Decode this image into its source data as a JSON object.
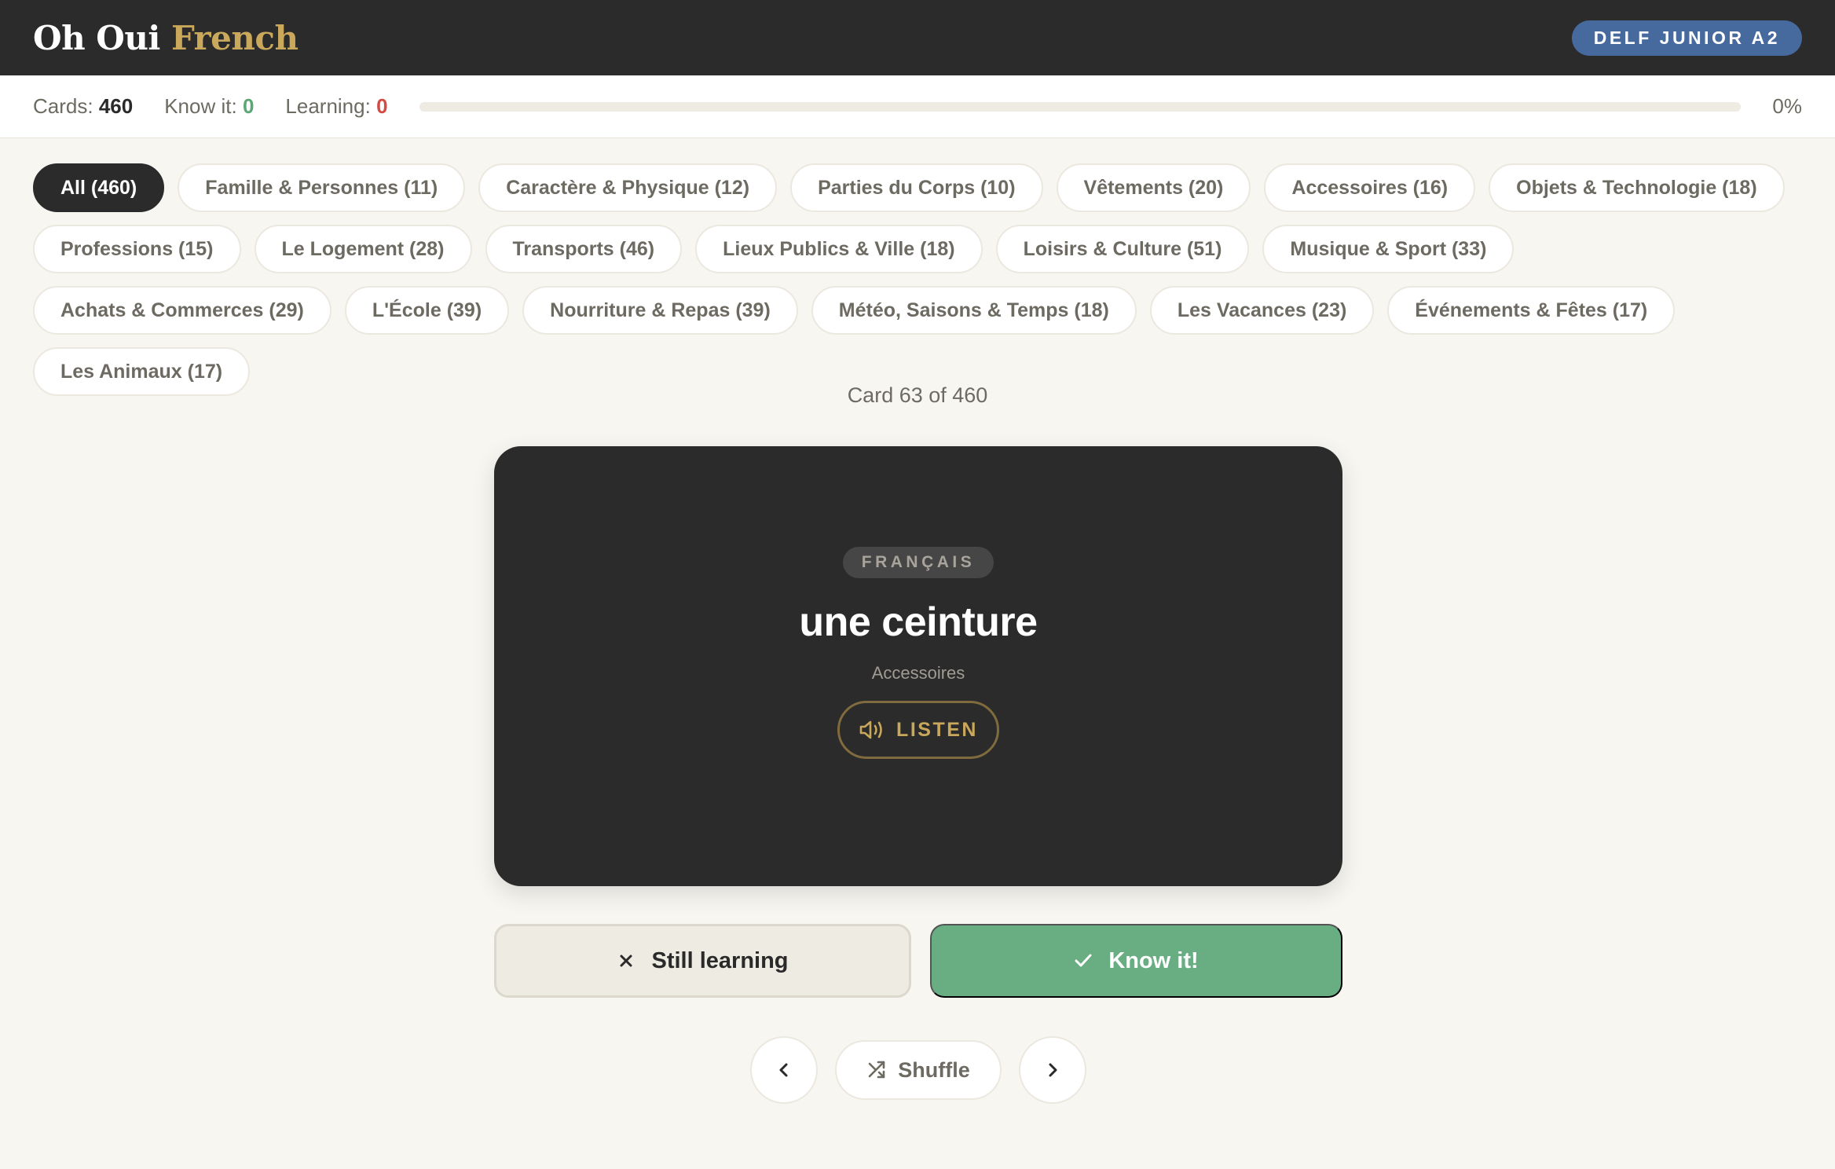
{
  "app": {
    "brand_main": "Oh Oui",
    "brand_accent": "French",
    "level_badge": "DELF JUNIOR A2"
  },
  "stats": {
    "cards_label": "Cards:",
    "cards_value": "460",
    "know_label": "Know it:",
    "know_value": "0",
    "learning_label": "Learning:",
    "learning_value": "0",
    "progress_fraction": 0,
    "progress_percent": "0%"
  },
  "categories": [
    {
      "label": "All (460)",
      "active": true
    },
    {
      "label": "Famille & Personnes (11)"
    },
    {
      "label": "Caractère & Physique (12)"
    },
    {
      "label": "Parties du Corps (10)"
    },
    {
      "label": "Vêtements (20)"
    },
    {
      "label": "Accessoires (16)"
    },
    {
      "label": "Objets & Technologie (18)"
    },
    {
      "label": "Professions (15)"
    },
    {
      "label": "Le Logement (28)"
    },
    {
      "label": "Transports (46)"
    },
    {
      "label": "Lieux Publics & Ville (18)"
    },
    {
      "label": "Loisirs & Culture (51)"
    },
    {
      "label": "Musique & Sport (33)"
    },
    {
      "label": "Achats & Commerces (29)"
    },
    {
      "label": "L'École (39)"
    },
    {
      "label": "Nourriture & Repas (39)"
    },
    {
      "label": "Météo, Saisons & Temps (18)"
    },
    {
      "label": "Les Vacances (23)"
    },
    {
      "label": "Événements & Fêtes (17)"
    },
    {
      "label": "Les Animaux (17)"
    }
  ],
  "counter": "Card 63 of 460",
  "card": {
    "language_tag": "FRANÇAIS",
    "word": "une ceinture",
    "category": "Accessoires",
    "listen_label": "LISTEN",
    "listen_icon": "speaker-icon"
  },
  "actions": {
    "still_learning_label": "Still learning",
    "still_learning_icon": "x-icon",
    "know_it_label": "Know it!",
    "know_it_icon": "check-icon"
  },
  "nav": {
    "prev_icon": "chevron-left-icon",
    "shuffle_label": "Shuffle",
    "shuffle_icon": "shuffle-icon",
    "next_icon": "chevron-right-icon"
  },
  "colors": {
    "header_bg": "#2b2b2b",
    "brand_accent": "#c9a85c",
    "badge_bg": "#46699e",
    "know_green": "#69ae82",
    "learning_red": "#d24b44",
    "page_bg": "#f8f6f1"
  }
}
